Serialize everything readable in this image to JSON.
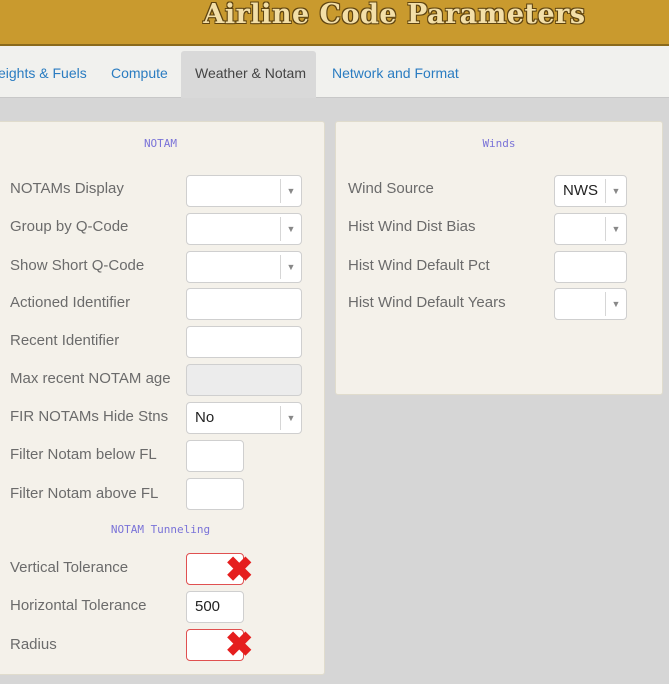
{
  "header": {
    "title": "Airline Code Parameters"
  },
  "tabs": [
    {
      "label": "eights & Fuels",
      "active": false
    },
    {
      "label": "Compute",
      "active": false
    },
    {
      "label": "Weather & Notam",
      "active": true
    },
    {
      "label": "Network and Format",
      "active": false
    }
  ],
  "notam": {
    "title": "NOTAM",
    "rows": [
      {
        "label": "NOTAMs Display",
        "value": ""
      },
      {
        "label": "Group by Q-Code",
        "value": ""
      },
      {
        "label": "Show Short Q-Code",
        "value": ""
      },
      {
        "label": "Actioned Identifier",
        "value": ""
      },
      {
        "label": "Recent Identifier",
        "value": ""
      },
      {
        "label": "Max recent NOTAM age",
        "value": ""
      },
      {
        "label": "FIR NOTAMs Hide Stns",
        "value": "No"
      },
      {
        "label": "Filter Notam below FL",
        "value": ""
      },
      {
        "label": "Filter Notam above FL",
        "value": ""
      }
    ],
    "tunneling_title": "NOTAM Tunneling",
    "tunneling": [
      {
        "label": "Vertical Tolerance",
        "value": ""
      },
      {
        "label": "Horizontal Tolerance",
        "value": "500"
      },
      {
        "label": "Radius",
        "value": ""
      }
    ]
  },
  "winds": {
    "title": "Winds",
    "rows": [
      {
        "label": "Wind Source",
        "value": "NWS"
      },
      {
        "label": "Hist Wind Dist Bias",
        "value": ""
      },
      {
        "label": "Hist Wind Default Pct",
        "value": ""
      },
      {
        "label": "Hist Wind Default Years",
        "value": ""
      }
    ]
  },
  "icons": {
    "error": "error-x-icon",
    "dropdown": "chevron-down-icon"
  },
  "colors": {
    "header": "#c99a2e",
    "tab_link": "#2a7cc1",
    "error": "#e51e1e",
    "section_title": "#7a73d8"
  }
}
